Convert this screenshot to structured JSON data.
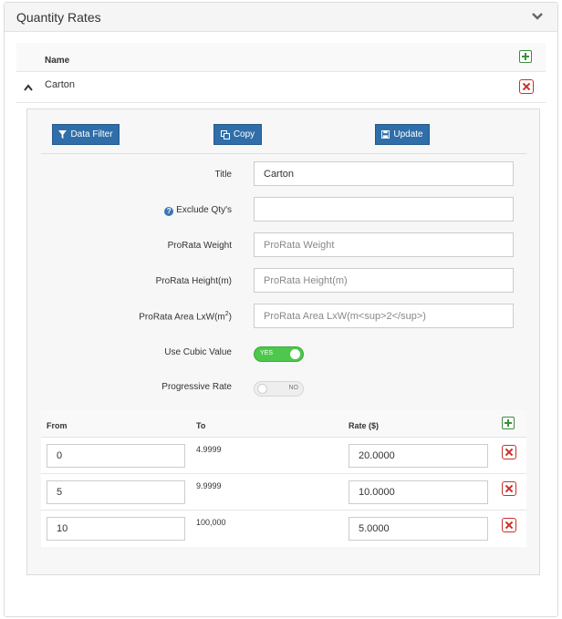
{
  "panel": {
    "title": "Quantity Rates"
  },
  "list": {
    "column_name": "Name",
    "rows": [
      {
        "name": "Carton"
      }
    ]
  },
  "toolbar": {
    "data_filter_label": "Data Filter",
    "copy_label": "Copy",
    "update_label": "Update"
  },
  "form": {
    "title": {
      "label": "Title",
      "value": "Carton",
      "placeholder": ""
    },
    "exclude_qtys": {
      "label": "Exclude Qty's",
      "value": "",
      "placeholder": ""
    },
    "prorata_weight": {
      "label": "ProRata Weight",
      "value": "",
      "placeholder": "ProRata Weight"
    },
    "prorata_height": {
      "label": "ProRata Height(m)",
      "value": "",
      "placeholder": "ProRata Height(m)"
    },
    "prorata_area": {
      "label_prefix": "ProRata Area LxW(m",
      "label_sup": "2",
      "label_suffix": ")",
      "value": "",
      "placeholder": "ProRata Area LxW(m<sup>2</sup>)"
    },
    "use_cubic_value": {
      "label": "Use Cubic Value",
      "state_text": "YES",
      "on": true
    },
    "progressive_rate": {
      "label": "Progressive Rate",
      "state_text": "NO",
      "on": false
    }
  },
  "rates": {
    "headers": {
      "from": "From",
      "to": "To",
      "rate": "Rate ($)"
    },
    "rows": [
      {
        "from": "0",
        "to": "4.9999",
        "rate": "20.0000"
      },
      {
        "from": "5",
        "to": "9.9999",
        "rate": "10.0000"
      },
      {
        "from": "10",
        "to": "100,000",
        "rate": "5.0000"
      }
    ]
  },
  "colors": {
    "primary_button": "#2f6ea8",
    "toggle_on": "#4cc94c",
    "add_green": "#3c8d3c",
    "delete_red": "#c9302c"
  }
}
